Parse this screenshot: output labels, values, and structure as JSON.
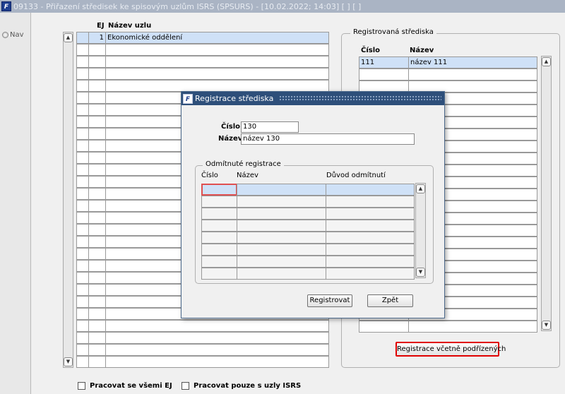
{
  "window": {
    "title": "09133 - Přiřazení středisek ke spisovým uzlům ISRS (SPSURS) - [10.02.2022; 14:03] [ ] [ ]"
  },
  "nav": {
    "label": "Nav"
  },
  "nodes_table": {
    "headers": {
      "ej": "EJ",
      "name": "Název uzlu"
    },
    "rows": [
      {
        "ej": "1",
        "name": "Ekonomické oddělení"
      }
    ]
  },
  "registered": {
    "legend": "Registrovaná střediska",
    "headers": {
      "number": "Číslo",
      "name": "Název"
    },
    "rows": [
      {
        "number": "111",
        "name": "název 111"
      }
    ],
    "register_sub_button": "Registrace včetně podřízených",
    "highlight_color": "#e00000"
  },
  "checkboxes": {
    "all_ej": "Pracovat se všemi EJ",
    "isrs_only": "Pracovat pouze s uzly ISRS"
  },
  "dialog": {
    "title": "Registrace střediska",
    "number_label": "Číslo",
    "number_value": "130",
    "name_label": "Název",
    "name_value": "název 130",
    "rejected": {
      "legend": "Odmítnuté registrace",
      "headers": {
        "number": "Číslo",
        "name": "Název",
        "reason": "Důvod odmítnutí"
      }
    },
    "register_button": "Registrovat",
    "back_button": "Zpět"
  },
  "colors": {
    "title_bar": "#aab4c4",
    "dialog_title_bar": "#2e4f7a",
    "selected_row": "#cfe1f7"
  }
}
